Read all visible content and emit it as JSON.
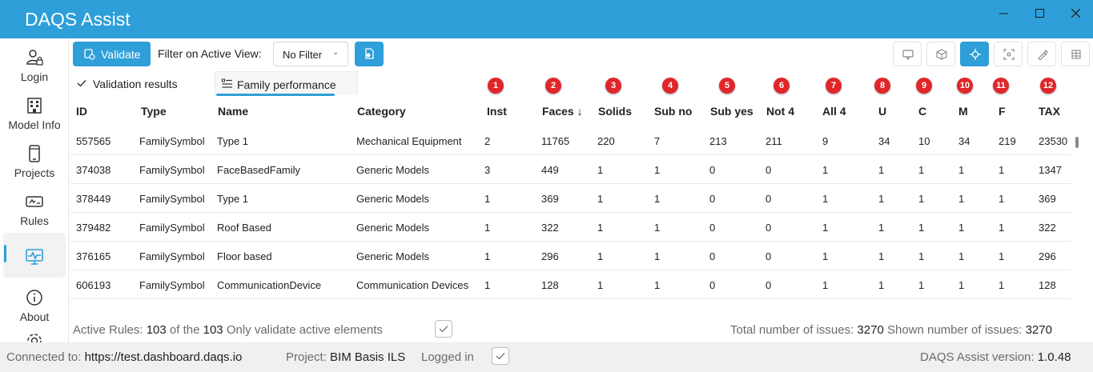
{
  "window": {
    "title": "DAQS Assist",
    "titlebar_color": "#2e9fd8",
    "minimize_icon": "minimize-icon",
    "maximize_icon": "maximize-icon",
    "close_icon": "close-icon"
  },
  "sidebar": {
    "items": [
      {
        "label": "Login",
        "icon": "user-lock-icon"
      },
      {
        "label": "Model Info",
        "icon": "building-icon"
      },
      {
        "label": "Projects",
        "icon": "phone-icon"
      },
      {
        "label": "Rules",
        "icon": "rules-icon"
      },
      {
        "label": "",
        "icon": "monitor-pulse-icon",
        "active": true
      },
      {
        "label": "About",
        "icon": "info-icon"
      },
      {
        "label": "",
        "icon": "settings-icon"
      }
    ]
  },
  "toolbar": {
    "validate_label": "Validate",
    "filter_label": "Filter on Active View:",
    "filter_value": "No Filter",
    "accent": "#2e9fd8"
  },
  "tabs": {
    "validation_results": "Validation results",
    "family_performance": "Family performance"
  },
  "table": {
    "columns": [
      "ID",
      "Type",
      "Name",
      "Category",
      "Inst",
      "Faces ↓",
      "Solids",
      "Sub no",
      "Sub yes",
      "Not 4",
      "All 4",
      "U",
      "C",
      "M",
      "F",
      "TAX"
    ],
    "badges": [
      "1",
      "2",
      "3",
      "4",
      "5",
      "6",
      "7",
      "8",
      "9",
      "10",
      "11",
      "12"
    ],
    "rows": [
      [
        "557565",
        "FamilySymbol",
        "Type 1",
        "Mechanical Equipment",
        "2",
        "11765",
        "220",
        "7",
        "213",
        "211",
        "9",
        "34",
        "10",
        "34",
        "219",
        "23530"
      ],
      [
        "374038",
        "FamilySymbol",
        "FaceBasedFamily",
        "Generic Models",
        "3",
        "449",
        "1",
        "1",
        "0",
        "0",
        "1",
        "1",
        "1",
        "1",
        "1",
        "1347"
      ],
      [
        "378449",
        "FamilySymbol",
        "Type 1",
        "Generic Models",
        "1",
        "369",
        "1",
        "1",
        "0",
        "0",
        "1",
        "1",
        "1",
        "1",
        "1",
        "369"
      ],
      [
        "379482",
        "FamilySymbol",
        "Roof Based",
        "Generic Models",
        "1",
        "322",
        "1",
        "1",
        "0",
        "0",
        "1",
        "1",
        "1",
        "1",
        "1",
        "322"
      ],
      [
        "376165",
        "FamilySymbol",
        "Floor based",
        "Generic Models",
        "1",
        "296",
        "1",
        "1",
        "0",
        "0",
        "1",
        "1",
        "1",
        "1",
        "1",
        "296"
      ],
      [
        "606193",
        "FamilySymbol",
        "CommunicationDevice",
        "Communication Devices",
        "1",
        "128",
        "1",
        "1",
        "0",
        "0",
        "1",
        "1",
        "1",
        "1",
        "1",
        "128"
      ]
    ]
  },
  "footer": {
    "active_rules_label": "Active Rules:",
    "active_rules_value": "103",
    "of_the_label": "of the",
    "total_rules_value": "103",
    "only_active_label": "Only validate active elements",
    "total_issues_label": "Total number of issues:",
    "total_issues_value": "3270",
    "shown_issues_label": "Shown number of issues:",
    "shown_issues_value": "3270"
  },
  "status": {
    "connected_label": "Connected to:",
    "connected_value": "https://test.dashboard.daqs.io",
    "project_label": "Project:",
    "project_value": "BIM Basis ILS",
    "logged_in_label": "Logged in",
    "version_label": "DAQS Assist version:",
    "version_value": "1.0.48"
  }
}
